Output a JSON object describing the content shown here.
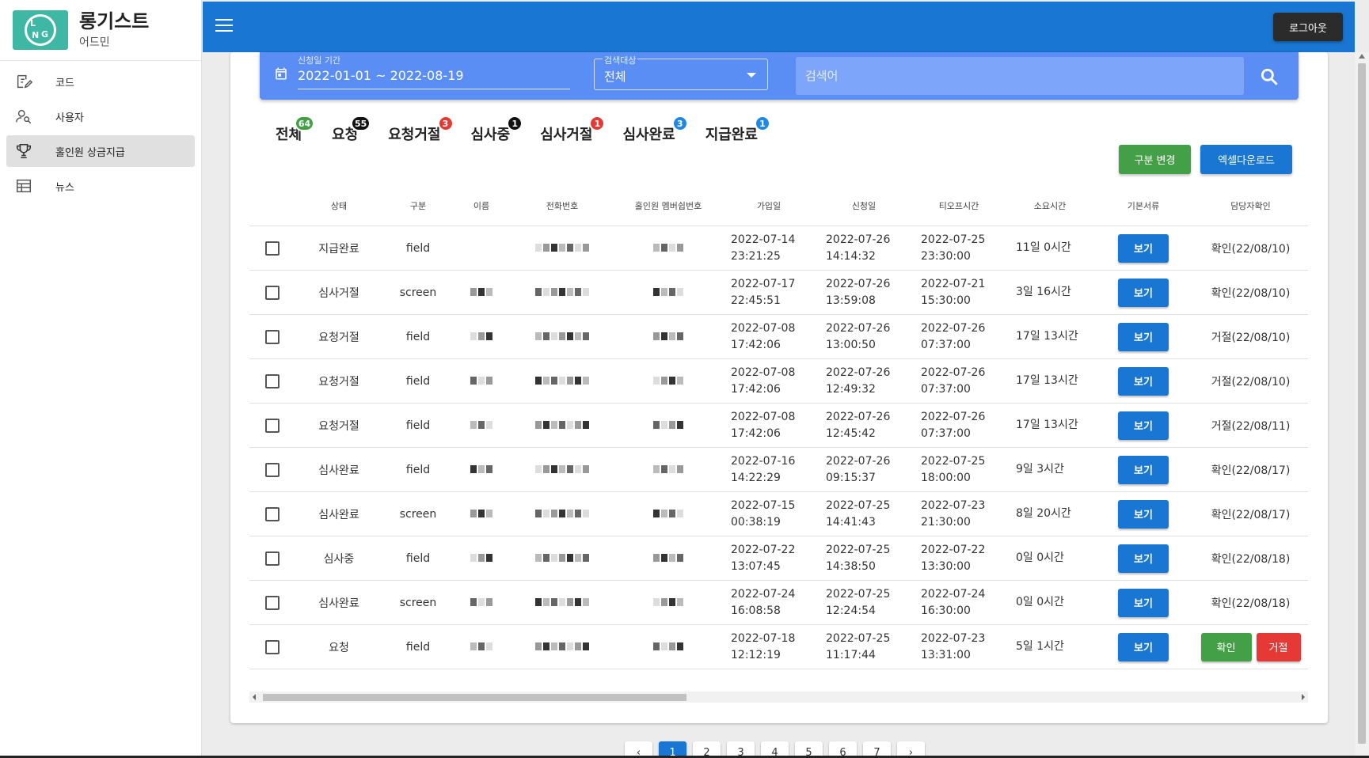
{
  "brand": {
    "title": "롱기스트",
    "subtitle": "어드민",
    "logo_text": "LNG"
  },
  "sidebar": {
    "items": [
      {
        "label": "코드",
        "icon": "edit-note-icon"
      },
      {
        "label": "사용자",
        "icon": "user-search-icon"
      },
      {
        "label": "홀인원 상금지급",
        "icon": "trophy-icon",
        "active": true
      },
      {
        "label": "뉴스",
        "icon": "news-table-icon"
      }
    ]
  },
  "topbar": {
    "logout_label": "로그아웃"
  },
  "filter": {
    "date_label": "신청일 기간",
    "date_value": "2022-01-01 ~ 2022-08-19",
    "target_label": "검색대상",
    "target_value": "전체",
    "search_placeholder": "검색어"
  },
  "tabs": [
    {
      "label": "전체",
      "count": "64",
      "color": "#43a047"
    },
    {
      "label": "요청",
      "count": "55",
      "color": "#111111"
    },
    {
      "label": "요청거절",
      "count": "3",
      "color": "#e53935"
    },
    {
      "label": "심사중",
      "count": "1",
      "color": "#111111"
    },
    {
      "label": "심사거절",
      "count": "1",
      "color": "#e53935"
    },
    {
      "label": "심사완료",
      "count": "3",
      "color": "#1e88e5"
    },
    {
      "label": "지급완료",
      "count": "1",
      "color": "#1e88e5"
    }
  ],
  "actions": {
    "change_label": "구분 변경",
    "excel_label": "엑셀다운로드"
  },
  "table": {
    "headers": [
      "",
      "상태",
      "구분",
      "이름",
      "전화번호",
      "홀인원 멤버쉽번호",
      "가입일",
      "신청일",
      "티오프시간",
      "소요시간",
      "기본서류",
      "담당자확인"
    ],
    "view_label": "보기",
    "confirm_label": "확인",
    "reject_label": "거절",
    "rows": [
      {
        "status": "지급완료",
        "type": "field",
        "joined": [
          "2022-07-14",
          "23:21:25"
        ],
        "applied": [
          "2022-07-26",
          "14:14:32"
        ],
        "teeoff": [
          "2022-07-25",
          "23:30:00"
        ],
        "elapsed": "11일 0시간",
        "check": "확인(22/08/10)"
      },
      {
        "status": "심사거절",
        "type": "screen",
        "joined": [
          "2022-07-17",
          "22:45:51"
        ],
        "applied": [
          "2022-07-26",
          "13:59:08"
        ],
        "teeoff": [
          "2022-07-21",
          "15:30:00"
        ],
        "elapsed": "3일 16시간",
        "check": "확인(22/08/10)"
      },
      {
        "status": "요청거절",
        "type": "field",
        "joined": [
          "2022-07-08",
          "17:42:06"
        ],
        "applied": [
          "2022-07-26",
          "13:00:50"
        ],
        "teeoff": [
          "2022-07-26",
          "07:37:00"
        ],
        "elapsed": "17일 13시간",
        "check": "거절(22/08/10)"
      },
      {
        "status": "요청거절",
        "type": "field",
        "joined": [
          "2022-07-08",
          "17:42:06"
        ],
        "applied": [
          "2022-07-26",
          "12:49:32"
        ],
        "teeoff": [
          "2022-07-26",
          "07:37:00"
        ],
        "elapsed": "17일 13시간",
        "check": "거절(22/08/10)"
      },
      {
        "status": "요청거절",
        "type": "field",
        "joined": [
          "2022-07-08",
          "17:42:06"
        ],
        "applied": [
          "2022-07-26",
          "12:45:42"
        ],
        "teeoff": [
          "2022-07-26",
          "07:37:00"
        ],
        "elapsed": "17일 13시간",
        "check": "거절(22/08/11)"
      },
      {
        "status": "심사완료",
        "type": "field",
        "joined": [
          "2022-07-16",
          "14:22:29"
        ],
        "applied": [
          "2022-07-26",
          "09:15:37"
        ],
        "teeoff": [
          "2022-07-25",
          "18:00:00"
        ],
        "elapsed": "9일 3시간",
        "check": "확인(22/08/17)"
      },
      {
        "status": "심사완료",
        "type": "screen",
        "joined": [
          "2022-07-15",
          "00:38:19"
        ],
        "applied": [
          "2022-07-25",
          "14:41:43"
        ],
        "teeoff": [
          "2022-07-23",
          "21:30:00"
        ],
        "elapsed": "8일 20시간",
        "check": "확인(22/08/17)"
      },
      {
        "status": "심사중",
        "type": "field",
        "joined": [
          "2022-07-22",
          "13:07:45"
        ],
        "applied": [
          "2022-07-25",
          "14:38:50"
        ],
        "teeoff": [
          "2022-07-22",
          "13:30:00"
        ],
        "elapsed": "0일 0시간",
        "check": "확인(22/08/18)"
      },
      {
        "status": "심사완료",
        "type": "screen",
        "joined": [
          "2022-07-24",
          "16:08:58"
        ],
        "applied": [
          "2022-07-25",
          "12:24:54"
        ],
        "teeoff": [
          "2022-07-24",
          "16:30:00"
        ],
        "elapsed": "0일 0시간",
        "check": "확인(22/08/18)"
      },
      {
        "status": "요청",
        "type": "field",
        "joined": [
          "2022-07-18",
          "12:12:19"
        ],
        "applied": [
          "2022-07-25",
          "11:17:44"
        ],
        "teeoff": [
          "2022-07-23",
          "13:31:00"
        ],
        "elapsed": "5일 1시간",
        "check": ""
      }
    ]
  },
  "pagination": {
    "pages": [
      "1",
      "2",
      "3",
      "4",
      "5",
      "6",
      "7"
    ],
    "current": "1",
    "prev": "‹",
    "next": "›"
  },
  "colors": {
    "primary": "#1976d2",
    "filter_bg": "#5b8ef5",
    "green": "#43a047",
    "red": "#e53935"
  }
}
